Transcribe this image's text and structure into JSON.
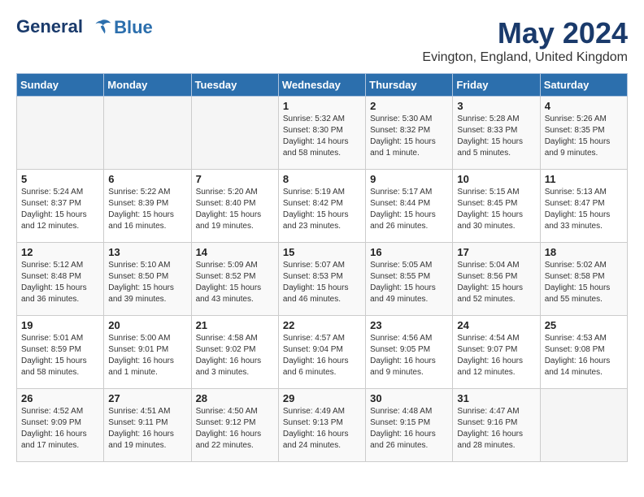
{
  "header": {
    "logo_line1": "General",
    "logo_line2": "Blue",
    "month": "May 2024",
    "location": "Evington, England, United Kingdom"
  },
  "weekdays": [
    "Sunday",
    "Monday",
    "Tuesday",
    "Wednesday",
    "Thursday",
    "Friday",
    "Saturday"
  ],
  "weeks": [
    [
      {
        "day": "",
        "info": ""
      },
      {
        "day": "",
        "info": ""
      },
      {
        "day": "",
        "info": ""
      },
      {
        "day": "1",
        "info": "Sunrise: 5:32 AM\nSunset: 8:30 PM\nDaylight: 14 hours\nand 58 minutes."
      },
      {
        "day": "2",
        "info": "Sunrise: 5:30 AM\nSunset: 8:32 PM\nDaylight: 15 hours\nand 1 minute."
      },
      {
        "day": "3",
        "info": "Sunrise: 5:28 AM\nSunset: 8:33 PM\nDaylight: 15 hours\nand 5 minutes."
      },
      {
        "day": "4",
        "info": "Sunrise: 5:26 AM\nSunset: 8:35 PM\nDaylight: 15 hours\nand 9 minutes."
      }
    ],
    [
      {
        "day": "5",
        "info": "Sunrise: 5:24 AM\nSunset: 8:37 PM\nDaylight: 15 hours\nand 12 minutes."
      },
      {
        "day": "6",
        "info": "Sunrise: 5:22 AM\nSunset: 8:39 PM\nDaylight: 15 hours\nand 16 minutes."
      },
      {
        "day": "7",
        "info": "Sunrise: 5:20 AM\nSunset: 8:40 PM\nDaylight: 15 hours\nand 19 minutes."
      },
      {
        "day": "8",
        "info": "Sunrise: 5:19 AM\nSunset: 8:42 PM\nDaylight: 15 hours\nand 23 minutes."
      },
      {
        "day": "9",
        "info": "Sunrise: 5:17 AM\nSunset: 8:44 PM\nDaylight: 15 hours\nand 26 minutes."
      },
      {
        "day": "10",
        "info": "Sunrise: 5:15 AM\nSunset: 8:45 PM\nDaylight: 15 hours\nand 30 minutes."
      },
      {
        "day": "11",
        "info": "Sunrise: 5:13 AM\nSunset: 8:47 PM\nDaylight: 15 hours\nand 33 minutes."
      }
    ],
    [
      {
        "day": "12",
        "info": "Sunrise: 5:12 AM\nSunset: 8:48 PM\nDaylight: 15 hours\nand 36 minutes."
      },
      {
        "day": "13",
        "info": "Sunrise: 5:10 AM\nSunset: 8:50 PM\nDaylight: 15 hours\nand 39 minutes."
      },
      {
        "day": "14",
        "info": "Sunrise: 5:09 AM\nSunset: 8:52 PM\nDaylight: 15 hours\nand 43 minutes."
      },
      {
        "day": "15",
        "info": "Sunrise: 5:07 AM\nSunset: 8:53 PM\nDaylight: 15 hours\nand 46 minutes."
      },
      {
        "day": "16",
        "info": "Sunrise: 5:05 AM\nSunset: 8:55 PM\nDaylight: 15 hours\nand 49 minutes."
      },
      {
        "day": "17",
        "info": "Sunrise: 5:04 AM\nSunset: 8:56 PM\nDaylight: 15 hours\nand 52 minutes."
      },
      {
        "day": "18",
        "info": "Sunrise: 5:02 AM\nSunset: 8:58 PM\nDaylight: 15 hours\nand 55 minutes."
      }
    ],
    [
      {
        "day": "19",
        "info": "Sunrise: 5:01 AM\nSunset: 8:59 PM\nDaylight: 15 hours\nand 58 minutes."
      },
      {
        "day": "20",
        "info": "Sunrise: 5:00 AM\nSunset: 9:01 PM\nDaylight: 16 hours\nand 1 minute."
      },
      {
        "day": "21",
        "info": "Sunrise: 4:58 AM\nSunset: 9:02 PM\nDaylight: 16 hours\nand 3 minutes."
      },
      {
        "day": "22",
        "info": "Sunrise: 4:57 AM\nSunset: 9:04 PM\nDaylight: 16 hours\nand 6 minutes."
      },
      {
        "day": "23",
        "info": "Sunrise: 4:56 AM\nSunset: 9:05 PM\nDaylight: 16 hours\nand 9 minutes."
      },
      {
        "day": "24",
        "info": "Sunrise: 4:54 AM\nSunset: 9:07 PM\nDaylight: 16 hours\nand 12 minutes."
      },
      {
        "day": "25",
        "info": "Sunrise: 4:53 AM\nSunset: 9:08 PM\nDaylight: 16 hours\nand 14 minutes."
      }
    ],
    [
      {
        "day": "26",
        "info": "Sunrise: 4:52 AM\nSunset: 9:09 PM\nDaylight: 16 hours\nand 17 minutes."
      },
      {
        "day": "27",
        "info": "Sunrise: 4:51 AM\nSunset: 9:11 PM\nDaylight: 16 hours\nand 19 minutes."
      },
      {
        "day": "28",
        "info": "Sunrise: 4:50 AM\nSunset: 9:12 PM\nDaylight: 16 hours\nand 22 minutes."
      },
      {
        "day": "29",
        "info": "Sunrise: 4:49 AM\nSunset: 9:13 PM\nDaylight: 16 hours\nand 24 minutes."
      },
      {
        "day": "30",
        "info": "Sunrise: 4:48 AM\nSunset: 9:15 PM\nDaylight: 16 hours\nand 26 minutes."
      },
      {
        "day": "31",
        "info": "Sunrise: 4:47 AM\nSunset: 9:16 PM\nDaylight: 16 hours\nand 28 minutes."
      },
      {
        "day": "",
        "info": ""
      }
    ]
  ]
}
